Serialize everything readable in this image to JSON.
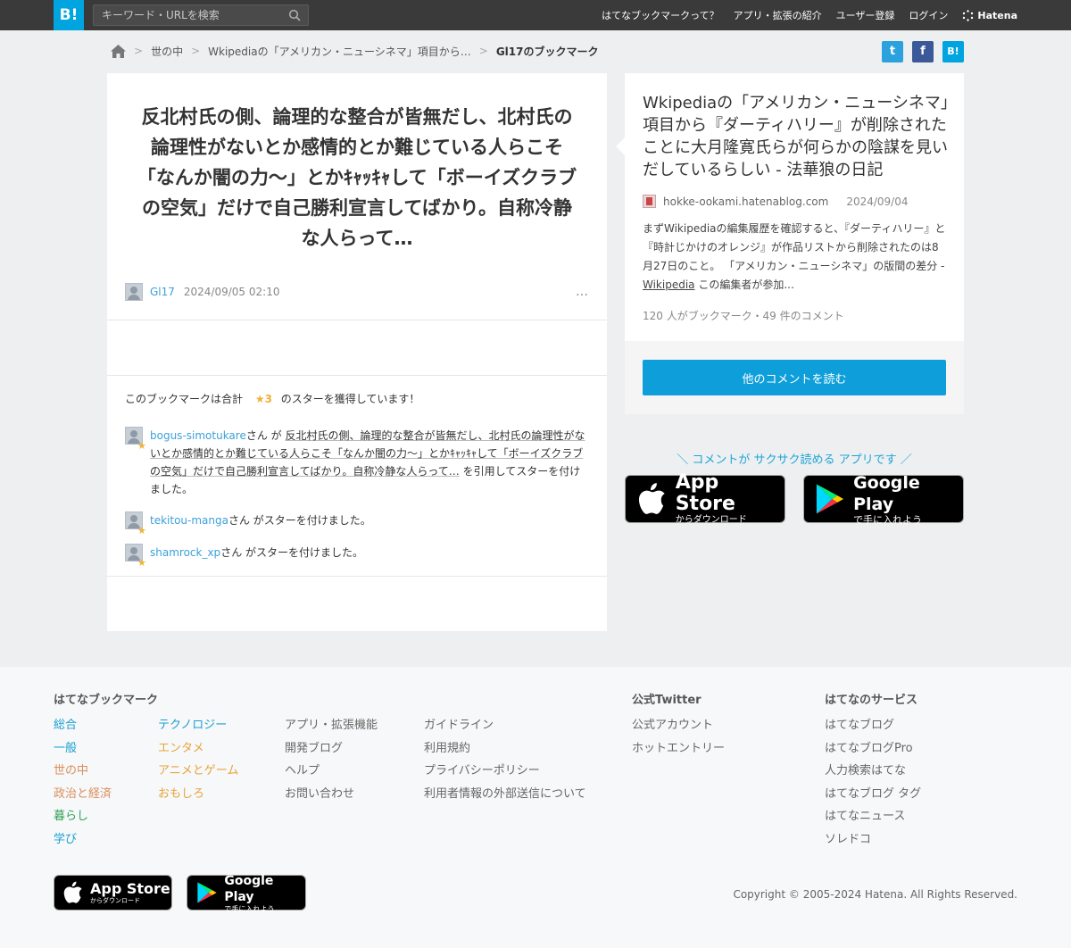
{
  "header": {
    "logo": "B!",
    "search_placeholder": "キーワード・URLを検索",
    "nav": [
      "はてなブックマークって？",
      "アプリ・拡張の紹介",
      "ユーザー登録",
      "ログイン"
    ],
    "brand": "Hatena"
  },
  "breadcrumb": {
    "items": [
      "世の中",
      "Wkipediaの「アメリカン・ニューシネマ」項目から…"
    ],
    "current": "Gl17のブックマーク"
  },
  "share": {
    "twitter": "t",
    "facebook": "f",
    "hatena": "B!"
  },
  "bookmark": {
    "comment": "反北村氏の側、論理的な整合が皆無だし、北村氏の論理性がないとか感情的とか難じている人らこそ「なんか闇の力〜」とかｷｬｯｷｬして「ボーイズクラブの空気」だけで自己勝利宣言してばかり。自称冷静な人らって…",
    "user": "Gl17",
    "datetime": "2024/09/05 02:10",
    "more": "…"
  },
  "stars": {
    "summary_prefix": "このブックマークは合計",
    "summary_count": "★3",
    "summary_suffix": "のスターを獲得しています！",
    "items": [
      {
        "user": "bogus-simotukare",
        "pre": "さん が ",
        "quote": "反北村氏の側、論理的な整合が皆無だし、北村氏の論理性がないとか感情的とか難じている人らこそ「なんか闇の力〜」とかｷｬｯｷｬして「ボーイズクラブの空気」だけで自己勝利宣言してばかり。自称冷静な人らって…",
        "post": " を引用してスターを付けました。"
      },
      {
        "user": "tekitou-manga",
        "post": "さん がスターを付けました。"
      },
      {
        "user": "shamrock_xp",
        "post": "さん がスターを付けました。"
      }
    ]
  },
  "entry": {
    "title": "Wkipediaの「アメリカン・ニューシネマ」項目から『ダーティハリー』が削除されたことに大月隆寛氏らが何らかの陰謀を見いだしているらしい - 法華狼の日記",
    "domain": "hokke-ookami.hatenablog.com",
    "date": "2024/09/04",
    "summary_text": "まずWikipediaの編集履歴を確認すると、『ダーティハリー』と『時計じかけのオレンジ』が作品リストから削除されたのは8月27日のこと。 「アメリカン・ニューシネマ」の版間の差分 - ",
    "summary_link": "Wikipedia",
    "summary_tail": " この編集者が参加...",
    "count_text": "120 人がブックマーク・49 件のコメント",
    "read_button": "他のコメントを読む"
  },
  "promo": {
    "text": "＼ コメントが サクサク読める アプリです ／",
    "appstore_big": "App Store",
    "appstore_small": "からダウンロード",
    "googleplay_big": "Google Play",
    "googleplay_small": "で手に入れよう"
  },
  "footer": {
    "section_bookmark": "はてなブックマーク",
    "col1": [
      "総合",
      "一般",
      "世の中",
      "政治と経済",
      "暮らし",
      "学び"
    ],
    "col2": [
      "テクノロジー",
      "エンタメ",
      "アニメとゲーム",
      "おもしろ"
    ],
    "col3": [
      "アプリ・拡張機能",
      "開発ブログ",
      "ヘルプ",
      "お問い合わせ"
    ],
    "col4": [
      "ガイドライン",
      "利用規約",
      "プライバシーポリシー",
      "利用者情報の外部送信について"
    ],
    "section_twitter": "公式Twitter",
    "twitter_links": [
      "公式アカウント",
      "ホットエントリー"
    ],
    "section_services": "はてなのサービス",
    "services": [
      "はてなブログ",
      "はてなブログPro",
      "人力検索はてな",
      "はてなブログ タグ",
      "はてなニュース",
      "ソレドコ"
    ],
    "copyright": "Copyright © 2005-2024 Hatena. All Rights Reserved."
  },
  "colors": {
    "accent": "#00a4de",
    "link": "#3ca0d8",
    "star": "#f2b134",
    "header_bg": "#3a3a3a",
    "button": "#0e9fdb"
  }
}
